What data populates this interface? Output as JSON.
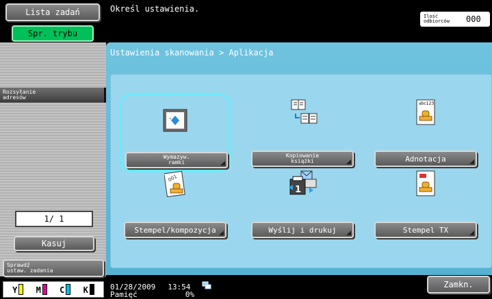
{
  "sidebar": {
    "job_list": "Lista zadań",
    "check_mode": "Spr. trybu",
    "address_send": "Rozsyłanie\nadresów",
    "page_indicator": "1/ 1",
    "delete": "Kasuj",
    "check_job_settings": "Sprawdź\nustaw. zadania"
  },
  "toner": [
    {
      "letter": "Y",
      "color": "#ffff00"
    },
    {
      "letter": "M",
      "color": "#e000a0"
    },
    {
      "letter": "C",
      "color": "#00c0e0"
    },
    {
      "letter": "K",
      "color": "#000000"
    }
  ],
  "header": {
    "message": "Określ ustawienia.",
    "recipients_label": "Ilość\nodbiorców",
    "recipients_count": "000"
  },
  "panel": {
    "breadcrumb": "Ustawienia skanowania > Aplikacja"
  },
  "apps": [
    {
      "label": "Wymazyw.\nramki",
      "icon": "frame-erase-icon",
      "selected": true
    },
    {
      "label": "Kopiowanie\nksiążki",
      "icon": "book-copy-icon",
      "selected": false
    },
    {
      "label": "Adnotacja",
      "icon": "annotation-icon",
      "selected": false
    },
    {
      "label": "Stempel/kompozycja",
      "icon": "stamp-composition-icon",
      "selected": false
    },
    {
      "label": "Wyślij i drukuj",
      "icon": "send-print-icon",
      "selected": false
    },
    {
      "label": "Stempel TX",
      "icon": "stamp-tx-icon",
      "selected": false
    }
  ],
  "footer": {
    "date": "01/28/2009",
    "time": "13:54",
    "memory_label": "Pamięć",
    "memory_value": "0%",
    "close": "Zamkn."
  },
  "colors": {
    "panel_bg": "#6fc3df",
    "inner_bg": "#9ad7ee",
    "accent_green": "#00c05a",
    "selection": "#5ef0ff"
  }
}
